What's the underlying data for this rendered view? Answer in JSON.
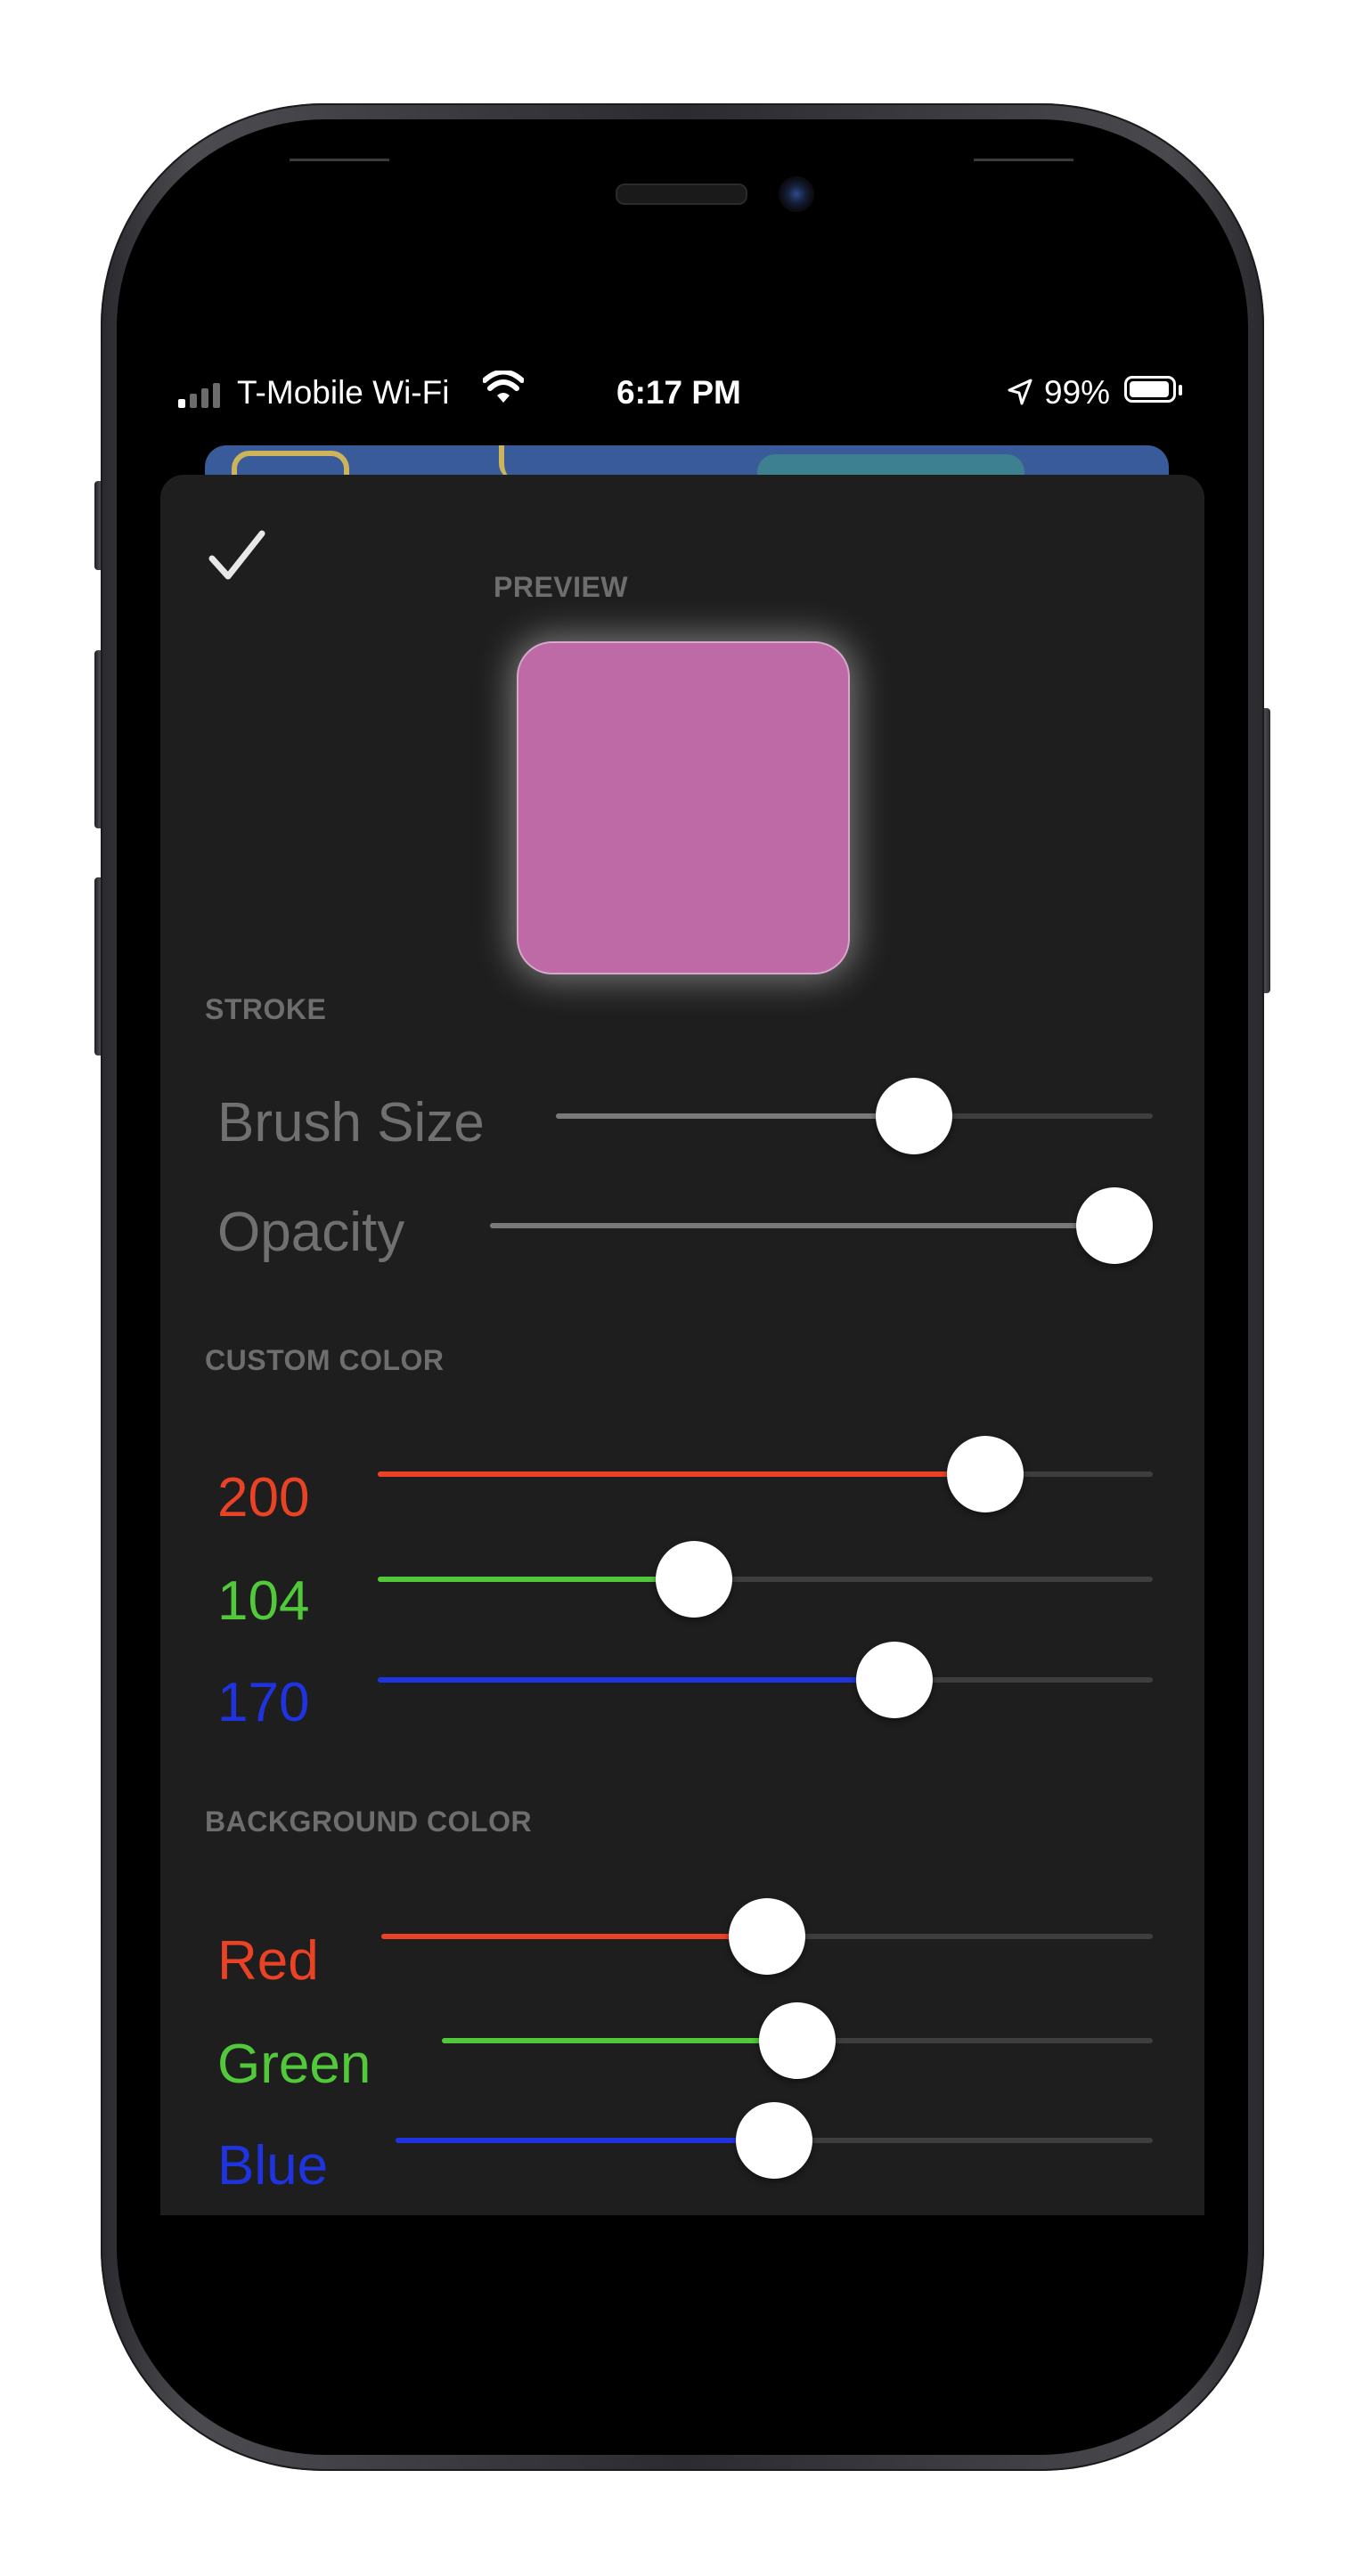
{
  "status_bar": {
    "carrier": "T-Mobile Wi-Fi",
    "time": "6:17 PM",
    "battery_percent": "99%",
    "signal_bars_active": 1,
    "signal_bars_total": 4,
    "icons": [
      "signal-bars-icon",
      "wifi-icon",
      "location-arrow-icon",
      "battery-icon"
    ]
  },
  "sheet": {
    "done_icon": "checkmark-icon",
    "preview": {
      "label": "PREVIEW",
      "swatch_color": "#bd6aa6"
    },
    "stroke": {
      "label": "STROKE",
      "brush_size": {
        "label": "Brush Size",
        "value": 0.6
      },
      "opacity": {
        "label": "Opacity",
        "value": 1.0
      }
    },
    "custom_color": {
      "label": "CUSTOM COLOR",
      "red": {
        "label": "200",
        "value": 200,
        "max": 255,
        "color": "#ea4225"
      },
      "green": {
        "label": "104",
        "value": 104,
        "max": 255,
        "color": "#52c93a"
      },
      "blue": {
        "label": "170",
        "value": 170,
        "max": 255,
        "color": "#1f34e0"
      }
    },
    "background_color": {
      "label": "BACKGROUND COLOR",
      "red": {
        "label": "Red",
        "value": 0.5,
        "color": "#ea4225"
      },
      "green": {
        "label": "Green",
        "value": 0.5,
        "color": "#52c93a"
      },
      "blue": {
        "label": "Blue",
        "value": 0.5,
        "color": "#1f34e0"
      }
    }
  }
}
